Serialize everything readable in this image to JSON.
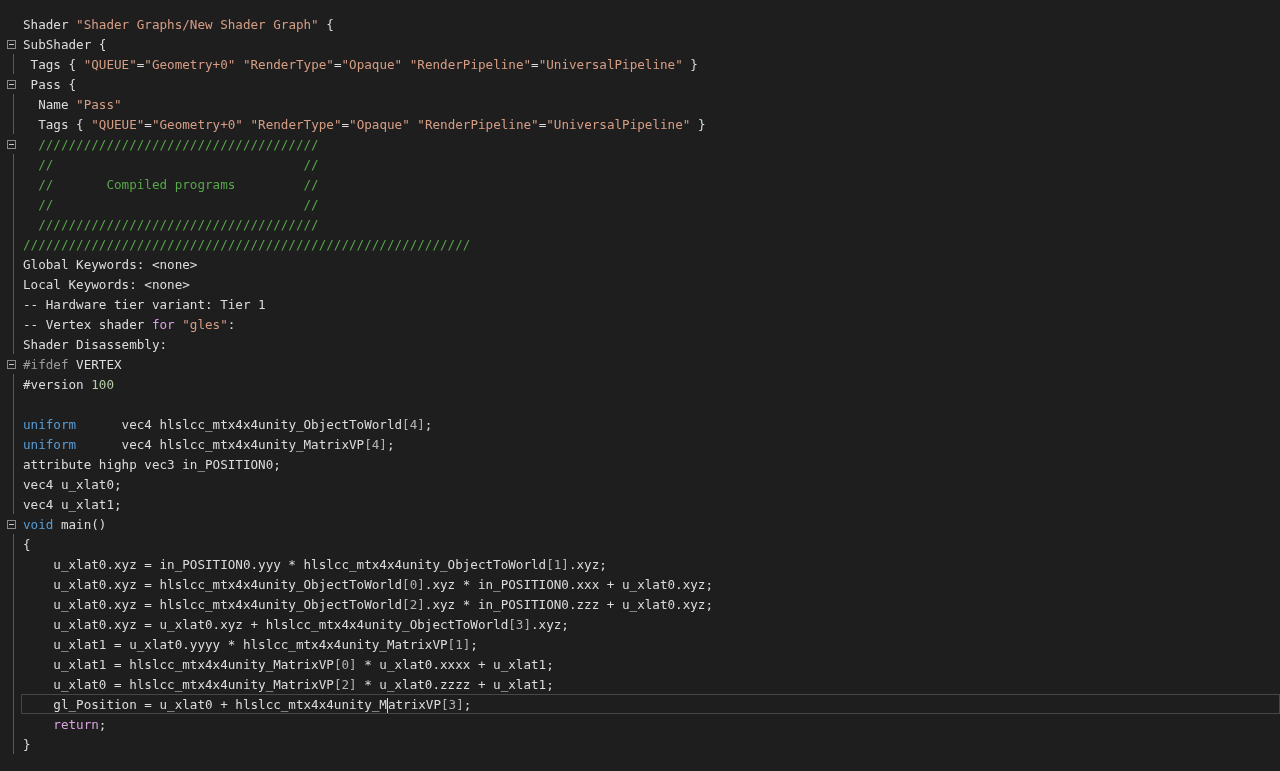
{
  "editor": {
    "lines": [
      {
        "current": false,
        "tokens": [
          {
            "kind": "plain",
            "text": "Shader "
          },
          {
            "kind": "string",
            "text": "\"Shader Graphs/New Shader Graph\""
          },
          {
            "kind": "plain",
            "text": " {"
          }
        ]
      },
      {
        "current": false,
        "expanded": true,
        "tokens": [
          {
            "kind": "plain",
            "text": "SubShader {"
          }
        ]
      },
      {
        "current": false,
        "tokens": [
          {
            "kind": "plain",
            "text": " Tags { "
          },
          {
            "kind": "string",
            "text": "\"QUEUE\""
          },
          {
            "kind": "plain",
            "text": "="
          },
          {
            "kind": "string",
            "text": "\"Geometry+0\" "
          },
          {
            "kind": "string",
            "text": "\"RenderType\""
          },
          {
            "kind": "plain",
            "text": "="
          },
          {
            "kind": "string",
            "text": "\"Opaque\" "
          },
          {
            "kind": "string",
            "text": "\"RenderPipeline\""
          },
          {
            "kind": "plain",
            "text": "="
          },
          {
            "kind": "string",
            "text": "\"UniversalPipeline\""
          },
          {
            "kind": "plain",
            "text": " }"
          }
        ]
      },
      {
        "current": false,
        "expanded": true,
        "tokens": [
          {
            "kind": "plain",
            "text": " Pass {"
          }
        ]
      },
      {
        "current": false,
        "tokens": [
          {
            "kind": "plain",
            "text": "  Name "
          },
          {
            "kind": "string",
            "text": "\"Pass\""
          }
        ]
      },
      {
        "current": false,
        "tokens": [
          {
            "kind": "plain",
            "text": "  Tags { "
          },
          {
            "kind": "string",
            "text": "\"QUEUE\""
          },
          {
            "kind": "plain",
            "text": "="
          },
          {
            "kind": "string",
            "text": "\"Geometry+0\" "
          },
          {
            "kind": "string",
            "text": "\"RenderType\""
          },
          {
            "kind": "plain",
            "text": "="
          },
          {
            "kind": "string",
            "text": "\"Opaque\" "
          },
          {
            "kind": "string",
            "text": "\"RenderPipeline\""
          },
          {
            "kind": "plain",
            "text": "="
          },
          {
            "kind": "string",
            "text": "\"UniversalPipeline\""
          },
          {
            "kind": "plain",
            "text": " }"
          }
        ]
      },
      {
        "current": false,
        "expanded": true,
        "tokens": [
          {
            "kind": "comment",
            "text": "  /////////////////////////////////////"
          }
        ]
      },
      {
        "current": false,
        "tokens": [
          {
            "kind": "comment",
            "text": "  //                                 //"
          }
        ]
      },
      {
        "current": false,
        "tokens": [
          {
            "kind": "comment",
            "text": "  //       Compiled programs         //"
          }
        ]
      },
      {
        "current": false,
        "tokens": [
          {
            "kind": "comment",
            "text": "  //                                 //"
          }
        ]
      },
      {
        "current": false,
        "tokens": [
          {
            "kind": "comment",
            "text": "  /////////////////////////////////////"
          }
        ]
      },
      {
        "current": false,
        "tokens": [
          {
            "kind": "comment",
            "text": "///////////////////////////////////////////////////////////"
          }
        ]
      },
      {
        "current": false,
        "tokens": [
          {
            "kind": "plain",
            "text": "Global Keywords: <none>"
          }
        ]
      },
      {
        "current": false,
        "tokens": [
          {
            "kind": "plain",
            "text": "Local Keywords: <none>"
          }
        ]
      },
      {
        "current": false,
        "tokens": [
          {
            "kind": "plain",
            "text": "-- Hardware tier variant: Tier 1"
          }
        ]
      },
      {
        "current": false,
        "tokens": [
          {
            "kind": "plain",
            "text": "-- Vertex shader "
          },
          {
            "kind": "control",
            "text": "for "
          },
          {
            "kind": "string",
            "text": "\"gles\""
          },
          {
            "kind": "plain",
            "text": ":"
          }
        ]
      },
      {
        "current": false,
        "tokens": [
          {
            "kind": "plain",
            "text": "Shader Disassembly:"
          }
        ]
      },
      {
        "current": false,
        "expanded": true,
        "tokens": [
          {
            "kind": "preprocessor",
            "text": "#ifdef"
          },
          {
            "kind": "plain",
            "text": " VERTEX"
          }
        ]
      },
      {
        "current": false,
        "tokens": [
          {
            "kind": "plain",
            "text": "#version "
          },
          {
            "kind": "number",
            "text": "100"
          }
        ]
      },
      {
        "current": false
      },
      {
        "current": false,
        "tokens": [
          {
            "kind": "keyword",
            "text": "uniform"
          },
          {
            "kind": "plain",
            "text": "      vec4 hlslcc_mtx4x4unity_ObjectToWorld"
          },
          {
            "kind": "bracket",
            "text": "[4]"
          },
          {
            "kind": "plain",
            "text": ";"
          }
        ]
      },
      {
        "current": false,
        "tokens": [
          {
            "kind": "keyword",
            "text": "uniform"
          },
          {
            "kind": "plain",
            "text": "      vec4 hlslcc_mtx4x4unity_MatrixVP"
          },
          {
            "kind": "bracket",
            "text": "[4]"
          },
          {
            "kind": "plain",
            "text": ";"
          }
        ]
      },
      {
        "current": false,
        "tokens": [
          {
            "kind": "plain",
            "text": "attribute highp vec3 in_POSITION0;"
          }
        ]
      },
      {
        "current": false,
        "tokens": [
          {
            "kind": "plain",
            "text": "vec4 u_xlat0;"
          }
        ]
      },
      {
        "current": false,
        "tokens": [
          {
            "kind": "plain",
            "text": "vec4 u_xlat1;"
          }
        ]
      },
      {
        "current": false,
        "expanded": true,
        "tokens": [
          {
            "kind": "keyword",
            "text": "void"
          },
          {
            "kind": "plain",
            "text": " main()"
          }
        ]
      },
      {
        "current": false,
        "tokens": [
          {
            "kind": "plain",
            "text": "{"
          }
        ]
      },
      {
        "current": false,
        "tokens": [
          {
            "kind": "plain",
            "text": "    u_xlat0.xyz = in_POSITION0.yyy * hlslcc_mtx4x4unity_ObjectToWorld"
          },
          {
            "kind": "bracket",
            "text": "[1]"
          },
          {
            "kind": "plain",
            "text": ".xyz;"
          }
        ]
      },
      {
        "current": false,
        "tokens": [
          {
            "kind": "plain",
            "text": "    u_xlat0.xyz = hlslcc_mtx4x4unity_ObjectToWorld"
          },
          {
            "kind": "bracket",
            "text": "[0]"
          },
          {
            "kind": "plain",
            "text": ".xyz * in_POSITION0.xxx + u_xlat0.xyz;"
          }
        ]
      },
      {
        "current": false,
        "tokens": [
          {
            "kind": "plain",
            "text": "    u_xlat0.xyz = hlslcc_mtx4x4unity_ObjectToWorld"
          },
          {
            "kind": "bracket",
            "text": "[2]"
          },
          {
            "kind": "plain",
            "text": ".xyz * in_POSITION0.zzz + u_xlat0.xyz;"
          }
        ]
      },
      {
        "current": false,
        "tokens": [
          {
            "kind": "plain",
            "text": "    u_xlat0.xyz = u_xlat0.xyz + hlslcc_mtx4x4unity_ObjectToWorld"
          },
          {
            "kind": "bracket",
            "text": "[3]"
          },
          {
            "kind": "plain",
            "text": ".xyz;"
          }
        ]
      },
      {
        "current": false,
        "tokens": [
          {
            "kind": "plain",
            "text": "    u_xlat1 = u_xlat0.yyyy * hlslcc_mtx4x4unity_MatrixVP"
          },
          {
            "kind": "bracket",
            "text": "[1]"
          },
          {
            "kind": "plain",
            "text": ";"
          }
        ]
      },
      {
        "current": false,
        "tokens": [
          {
            "kind": "plain",
            "text": "    u_xlat1 = hlslcc_mtx4x4unity_MatrixVP"
          },
          {
            "kind": "bracket",
            "text": "[0]"
          },
          {
            "kind": "plain",
            "text": " * u_xlat0.xxxx + u_xlat1;"
          }
        ]
      },
      {
        "current": false,
        "tokens": [
          {
            "kind": "plain",
            "text": "    u_xlat0 = hlslcc_mtx4x4unity_MatrixVP"
          },
          {
            "kind": "bracket",
            "text": "[2]"
          },
          {
            "kind": "plain",
            "text": " * u_xlat0.zzzz + u_xlat1;"
          }
        ]
      },
      {
        "current": true,
        "tokens": [
          {
            "kind": "plain",
            "text": "    gl_Position = u_xlat0 + hlslcc_mtx4x4unity_M",
            "caret_after": true
          },
          {
            "kind": "plain",
            "text": "atrixVP"
          },
          {
            "kind": "bracket",
            "text": "[3]"
          },
          {
            "kind": "plain",
            "text": ";"
          }
        ]
      },
      {
        "current": false,
        "tokens": [
          {
            "kind": "control",
            "text": "    return"
          },
          {
            "kind": "plain",
            "text": ";"
          }
        ]
      },
      {
        "current": false,
        "tokens": [
          {
            "kind": "plain",
            "text": "}"
          }
        ]
      }
    ]
  }
}
